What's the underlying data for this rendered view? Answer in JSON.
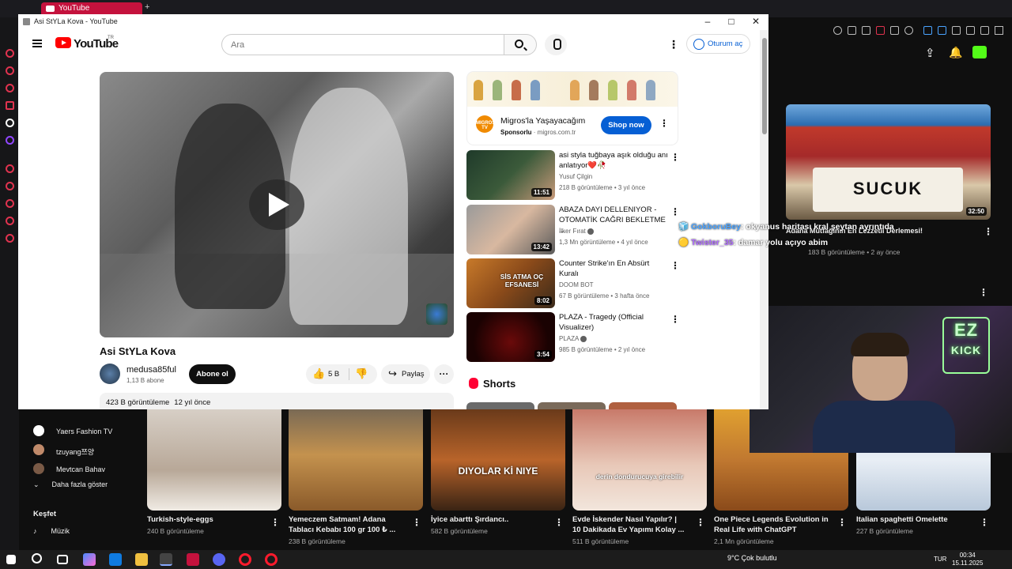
{
  "browser": {
    "tab_title": "YouTube",
    "new_tab_symbol": "+"
  },
  "window": {
    "title": "Asi StYLa Kova - YouTube",
    "minimize": "–",
    "maximize": "□",
    "close": "✕"
  },
  "masthead": {
    "logo_text": "YouTube",
    "region": "TR",
    "search_placeholder": "Ara",
    "signin_label": "Oturum aç"
  },
  "video": {
    "title": "Asi StYLa Kova",
    "channel": "medusa85ful",
    "subscribers": "1,13 B abone",
    "subscribe_label": "Abone ol",
    "likes": "5 B",
    "share_label": "Paylaş",
    "views": "423 B görüntüleme",
    "date": "12 yıl önce"
  },
  "ad": {
    "title": "Migros'la Yaşayacağım",
    "sponsor_label": "Sponsorlu",
    "domain": "migros.com.tr",
    "cta": "Shop now",
    "logo_text": "MIGROS TV"
  },
  "recommendations": [
    {
      "title": "asi styla tuğbaya aşık olduğu anı anlatıyor❤️🥀",
      "channel": "Yusuf Çilgin",
      "meta": "218 B görüntüleme • 3 yıl önce",
      "duration": "11:51",
      "verified": false
    },
    {
      "title": "ABAZA DAYI DELLENIYOR - OTOMATİK CAĞRI BEKLETME ...",
      "channel": "İlker Fırat",
      "meta": "1,3 Mn görüntüleme • 4 yıl önce",
      "duration": "13:42",
      "verified": true
    },
    {
      "title": "Counter Strike'ın En Absürt Kuralı",
      "channel": "DOOM BOT",
      "meta": "67 B görüntüleme • 3 hafta önce",
      "duration": "8:02",
      "verified": false,
      "thumb_text": "SİS ATMA OÇ EFSANESİ"
    },
    {
      "title": "PLAZA - Tragedy (Official Visualizer)",
      "channel": "PLAZA",
      "meta": "985 B görüntüleme • 2 yıl önce",
      "duration": "3:54",
      "verified": true
    }
  ],
  "shorts": {
    "title": "Shorts"
  },
  "bg_sidebar": {
    "subs": [
      {
        "name": "Yaers Fashion TV",
        "color": "#ffffff"
      },
      {
        "name": "tzuyang쯔양",
        "color": "#c08a6a"
      },
      {
        "name": "Mevtcan Bahav",
        "color": "#7a5a46"
      }
    ],
    "more_label": "Daha fazla göster",
    "explore_label": "Keşfet",
    "music_label": "Müzik"
  },
  "bottom_cards": [
    {
      "title": "Turkish-style-eggs",
      "meta": "240 B görüntüleme",
      "color": "#c8b8a8"
    },
    {
      "title": "Yemeczem Satmam! Adana Tablacı Kebabı 100 gr 100 ₺ ...",
      "meta": "238 B görüntüleme",
      "color": "#b88a5a"
    },
    {
      "title": "İyice abarttı Şırdancı..",
      "meta": "582 B görüntüleme",
      "color": "#a0522d",
      "overlay": "DIYOLAR Kİ NIYE"
    },
    {
      "title": "Evde İskender Nasıl Yapılır? | 10 Dakikada Ev Yapımı Kolay ...",
      "meta": "511 B görüntüleme",
      "color": "#d8b4a0",
      "overlay": "derin dondurucuya girebilir"
    },
    {
      "title": "One Piece Legends Evolution in Real Life with ChatGPT",
      "meta": "2,1 Mn görüntüleme",
      "color": "#c8902a"
    },
    {
      "title": "Italian spaghetti Omelette",
      "meta": "227 B görüntüleme",
      "color": "#dfe8f2"
    }
  ],
  "right_panel": {
    "card_sign": "SUCUK",
    "card_duration": "32:50",
    "card_title": "Adana Mutfağının En Lezzetli Derlemesi!",
    "card_meta": "183 B görüntüleme • 2 ay önce",
    "overlay_text": "okyanus haritası kral şeytan ayrıntıda"
  },
  "chat": [
    {
      "user": "GokboruBey",
      "message": ": okyanus haritası kral şeytan ayrıntıda"
    },
    {
      "user": "Twister_35",
      "message": ": damar yolu açıyo abim"
    }
  ],
  "webcam": {
    "sign_top": "EZ",
    "sign_bottom": "KICK"
  },
  "taskbar": {
    "weather": "9°C  Çok bulutlu",
    "lang": "TUR",
    "time": "00:34",
    "date": "15.11.2025"
  }
}
